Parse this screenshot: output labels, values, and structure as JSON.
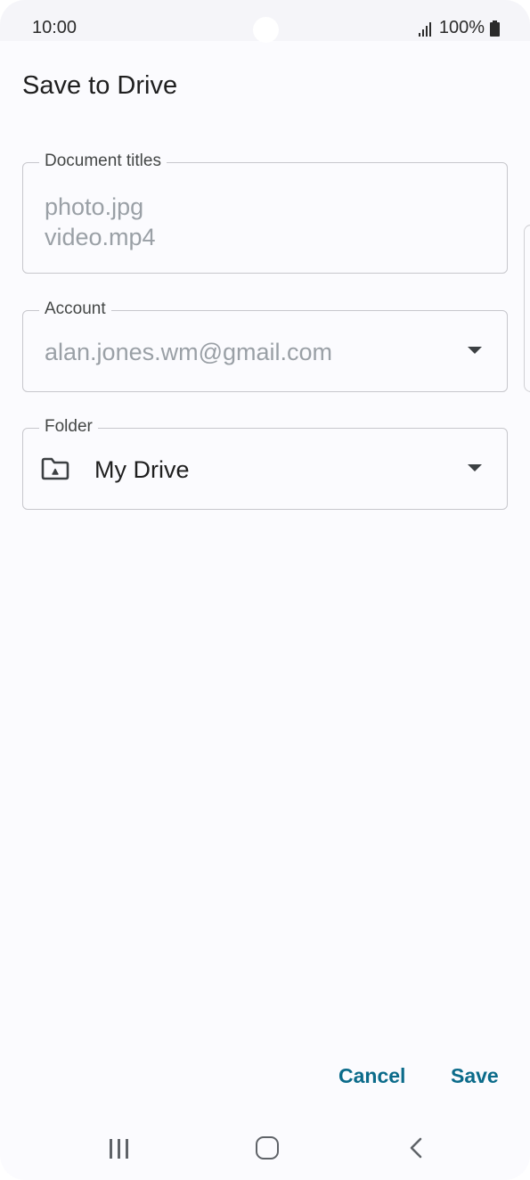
{
  "status_bar": {
    "time": "10:00",
    "battery": "100%",
    "icons": [
      "signal-icon",
      "battery-icon"
    ]
  },
  "dialog": {
    "title": "Save to Drive",
    "document_titles": {
      "label": "Document titles",
      "values": [
        "photo.jpg",
        "video.mp4"
      ]
    },
    "account": {
      "label": "Account",
      "value": "alan.jones.wm@gmail.com",
      "icon": "chevron-down-icon"
    },
    "folder": {
      "label": "Folder",
      "value": "My Drive",
      "icon": "drive-folder-icon"
    },
    "buttons": {
      "cancel": "Cancel",
      "save": "Save"
    }
  },
  "nav_bar": {
    "icons": [
      "recent-apps-icon",
      "home-icon",
      "back-icon"
    ]
  },
  "colors": {
    "accent": "#0b6b8a",
    "background": "#fbfbfe",
    "border": "#c7c7cc",
    "placeholder_text": "#9aa0a6"
  }
}
